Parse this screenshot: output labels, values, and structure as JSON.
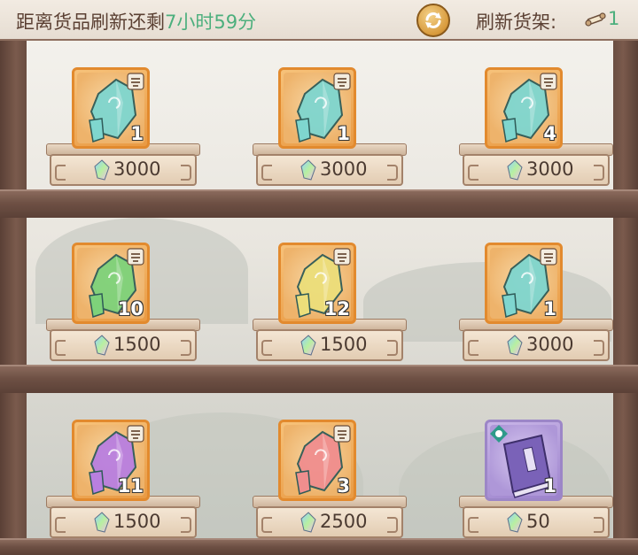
{
  "header": {
    "countdown_prefix": "距离货品刷新还剩",
    "countdown_value": "7小时59分",
    "refresh_label": "刷新货架:",
    "refresh_count": "1",
    "time_color": "#4caf7d"
  },
  "items": [
    {
      "gem": "teal",
      "qty": "1",
      "price": "3000"
    },
    {
      "gem": "teal",
      "qty": "1",
      "price": "3000"
    },
    {
      "gem": "teal",
      "qty": "4",
      "price": "3000"
    },
    {
      "gem": "green",
      "qty": "10",
      "price": "1500"
    },
    {
      "gem": "yellow",
      "qty": "12",
      "price": "1500"
    },
    {
      "gem": "teal",
      "qty": "1",
      "price": "3000"
    },
    {
      "gem": "purple",
      "qty": "11",
      "price": "1500"
    },
    {
      "gem": "pink",
      "qty": "3",
      "price": "2500"
    },
    {
      "gem": "book",
      "qty": "1",
      "price": "50"
    }
  ],
  "gem_colors": {
    "teal": "#7fd6cf",
    "green": "#7ed27a",
    "yellow": "#ecde7a",
    "purple": "#b97fe0",
    "pink": "#f08e8e",
    "book": "#7a62b8"
  },
  "icons": {
    "refresh": "refresh-arrows-icon",
    "scroll": "scroll-icon",
    "badge": "bag-badge-icon",
    "currency": "rainbow-crystal-icon"
  }
}
